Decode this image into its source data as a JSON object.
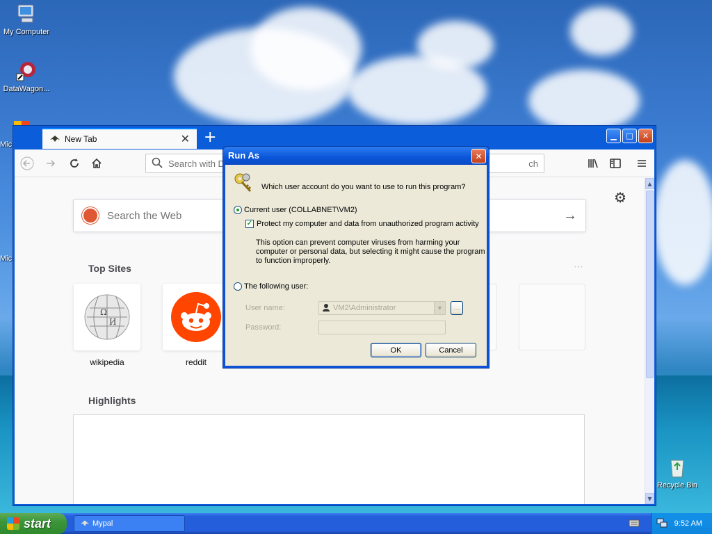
{
  "desktop": {
    "icons": [
      {
        "label": "My Computer"
      },
      {
        "label": "DataWagon..."
      },
      {
        "label": "Mic"
      },
      {
        "label": "Mic"
      },
      {
        "label": "Recycle Bin"
      }
    ]
  },
  "browser": {
    "tab_title": "New Tab",
    "tab_close": "✕",
    "new_tab": "+",
    "urlbar_placeholder": "Search with D",
    "urlbar_tail": "ch",
    "search_web_placeholder": "Search the Web",
    "top_sites_heading": "Top Sites",
    "highlights_heading": "Highlights",
    "sites": [
      {
        "label": "wikipedia"
      },
      {
        "label": "reddit"
      }
    ]
  },
  "dialog": {
    "title": "Run As",
    "close": "✕",
    "question": "Which user account do you want to use to run this program?",
    "current_user_label": "Current user (COLLABNET\\VM2)",
    "protect_label": "Protect my computer and data from unauthorized program activity",
    "protect_desc": "This option can prevent computer viruses from harming your computer or personal data, but selecting it might cause the program to function improperly.",
    "following_user_label": "The following user:",
    "user_name_label": "User name:",
    "user_name_value": "VM2\\Administrator",
    "password_label": "Password:",
    "browse_label": "...",
    "ok_label": "OK",
    "cancel_label": "Cancel"
  },
  "taskbar": {
    "start_label": "start",
    "task_label": "Mypal",
    "clock": "9:52 AM"
  }
}
